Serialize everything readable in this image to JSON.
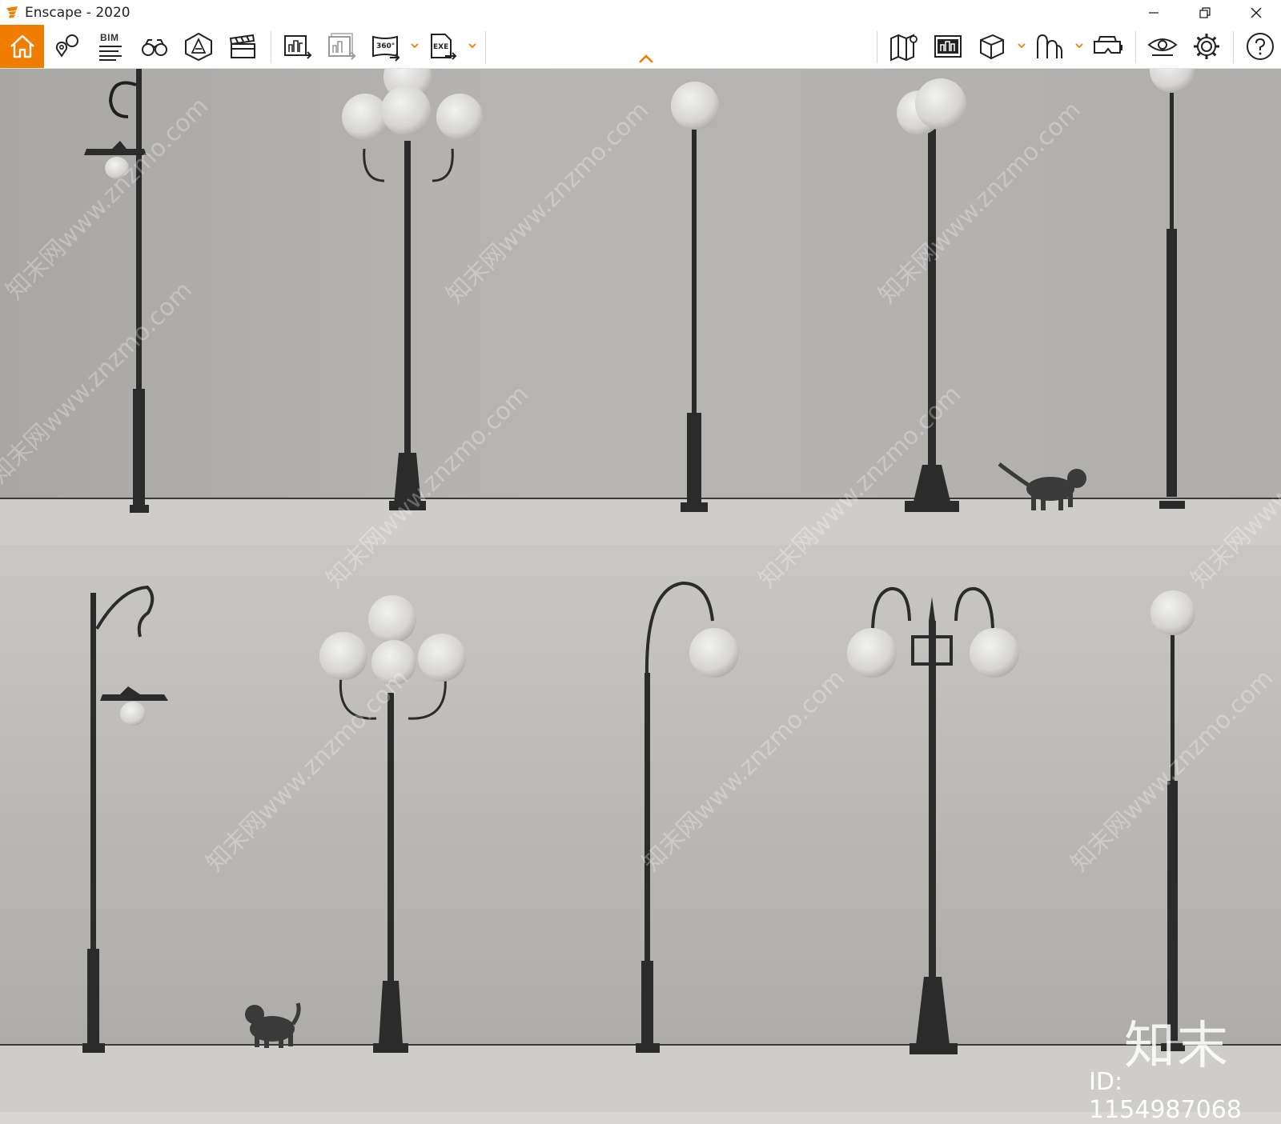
{
  "window": {
    "title": "Enscape - 2020",
    "controls": {
      "minimize": "minimize-icon",
      "restore": "restore-icon",
      "close": "close-icon"
    }
  },
  "toolbar": {
    "accent": "#f07c00",
    "left_tools": [
      {
        "name": "home",
        "icon": "home-icon",
        "active": true
      },
      {
        "name": "location",
        "icon": "location-pins-icon"
      },
      {
        "name": "bim",
        "icon": "bim-info-icon",
        "label": "BIM"
      },
      {
        "name": "views",
        "icon": "binoculars-icon"
      },
      {
        "name": "fov",
        "icon": "perspective-icon"
      },
      {
        "name": "video",
        "icon": "clapperboard-icon"
      },
      {
        "name": "render-image",
        "icon": "render-image-icon"
      },
      {
        "name": "batch-render",
        "icon": "batch-render-icon"
      },
      {
        "name": "panorama",
        "icon": "panorama-360-icon",
        "label": "360°",
        "dropdown": true
      },
      {
        "name": "export-exe",
        "icon": "export-exe-icon",
        "label": "EXE",
        "dropdown": true
      }
    ],
    "right_tools": [
      {
        "name": "map",
        "icon": "map-icon"
      },
      {
        "name": "asset-library",
        "icon": "asset-library-icon"
      },
      {
        "name": "material",
        "icon": "cube-icon",
        "dropdown": true
      },
      {
        "name": "sync",
        "icon": "sync-icon",
        "dropdown": true
      },
      {
        "name": "vr",
        "icon": "vr-headset-icon"
      },
      {
        "name": "visual-settings",
        "icon": "eye-icon"
      },
      {
        "name": "settings",
        "icon": "gear-icon"
      },
      {
        "name": "help",
        "icon": "help-icon"
      }
    ]
  },
  "viewport": {
    "watermark_text": "知末网www.znzmo.com",
    "logo_text": "知末",
    "id_text": "ID: 1154987068"
  }
}
